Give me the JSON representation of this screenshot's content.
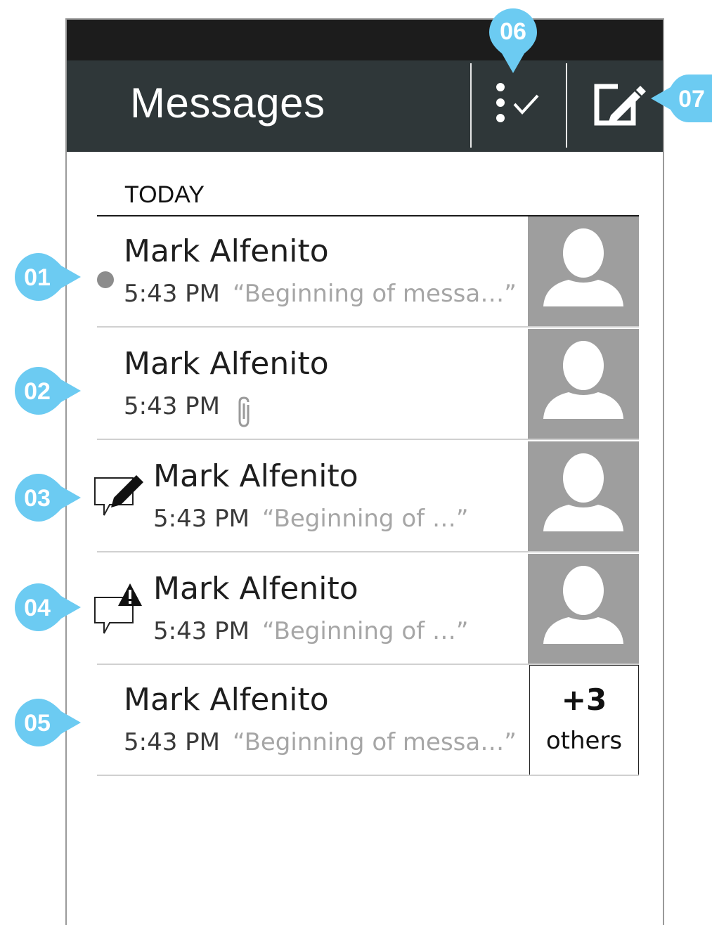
{
  "app": {
    "title": "Messages",
    "select_icon": "more-vert-check-icon",
    "compose_icon": "compose-icon"
  },
  "section": {
    "label": "TODAY"
  },
  "messages": [
    {
      "name": "Mark Alfenito",
      "time": "5:43 PM",
      "preview": "“Beginning of messa…”",
      "indicator": "unread-dot"
    },
    {
      "name": "Mark Alfenito",
      "time": "5:43 PM",
      "preview": "",
      "indicator": "none",
      "attachment_icon": "paperclip-icon"
    },
    {
      "name": "Mark Alfenito",
      "time": "5:43 PM",
      "preview": "“Beginning of …”",
      "indicator": "draft-icon"
    },
    {
      "name": "Mark Alfenito",
      "time": "5:43 PM",
      "preview": "“Beginning of …”",
      "indicator": "error-icon"
    },
    {
      "name": "Mark Alfenito",
      "time": "5:43 PM",
      "preview": "“Beginning of messa…”",
      "indicator": "none",
      "group": {
        "count": "+3",
        "label": "others"
      }
    }
  ],
  "callouts": [
    "01",
    "02",
    "03",
    "04",
    "05",
    "06",
    "07"
  ],
  "colors": {
    "appbar": "#2f3739",
    "statusbar": "#1c1c1c",
    "avatar": "#9e9e9e",
    "callout": "#6ccbf2",
    "preview_text": "#a6a6a6"
  }
}
